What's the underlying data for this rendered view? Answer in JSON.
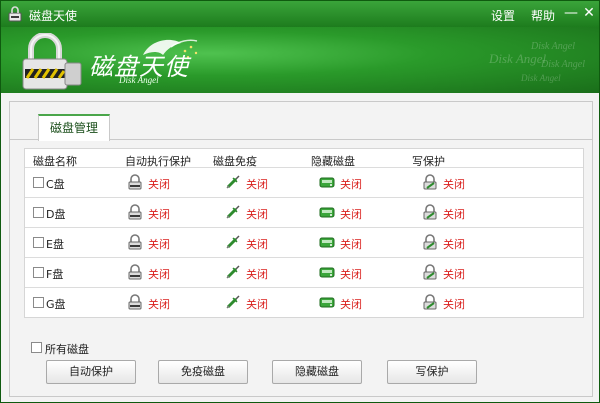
{
  "titlebar": {
    "title": "磁盘天使",
    "settings_label": "设置",
    "help_label": "帮助",
    "minimize_glyph": "—",
    "close_glyph": "✕"
  },
  "banner": {
    "brand_cn": "磁盘天使",
    "brand_en": "Disk Angel",
    "watermark": "Disk Angel"
  },
  "tabs": [
    {
      "label": "磁盘管理",
      "active": true
    }
  ],
  "table": {
    "headers": [
      "磁盘名称",
      "自动执行保护",
      "磁盘免疫",
      "隐藏磁盘",
      "写保护"
    ],
    "rows": [
      {
        "drive": "C盘",
        "checked": false,
        "autorun": "关闭",
        "immunity": "关闭",
        "hide": "关闭",
        "write_protect": "关闭"
      },
      {
        "drive": "D盘",
        "checked": false,
        "autorun": "关闭",
        "immunity": "关闭",
        "hide": "关闭",
        "write_protect": "关闭"
      },
      {
        "drive": "E盘",
        "checked": false,
        "autorun": "关闭",
        "immunity": "关闭",
        "hide": "关闭",
        "write_protect": "关闭"
      },
      {
        "drive": "F盘",
        "checked": false,
        "autorun": "关闭",
        "immunity": "关闭",
        "hide": "关闭",
        "write_protect": "关闭"
      },
      {
        "drive": "G盘",
        "checked": false,
        "autorun": "关闭",
        "immunity": "关闭",
        "hide": "关闭",
        "write_protect": "关闭"
      }
    ]
  },
  "all_disks_label": "所有磁盘",
  "buttons": {
    "auto_protect": "自动保护",
    "immunize": "免疫磁盘",
    "hide": "隐藏磁盘",
    "write_protect": "写保护"
  },
  "colors": {
    "status_off": "#d9201d",
    "brand_green": "#2a9a2a"
  },
  "icons": {
    "autorun": "lock-shield-icon",
    "immunity": "syringe-icon",
    "hide": "hidden-disk-icon",
    "write_protect": "write-lock-icon"
  }
}
